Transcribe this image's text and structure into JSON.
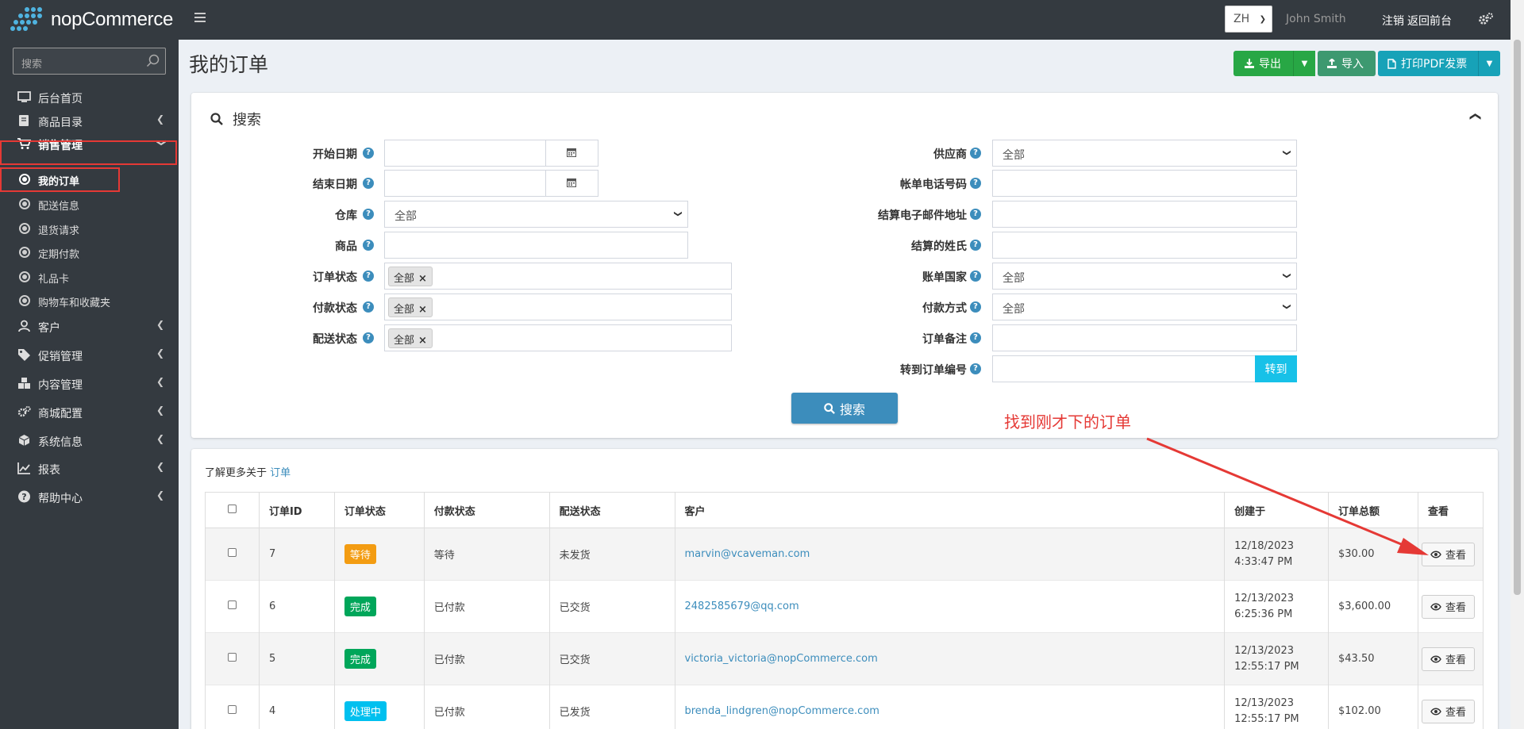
{
  "brand": {
    "name": "nopCommerce"
  },
  "topbar": {
    "language": "ZH",
    "user": "John Smith",
    "logout": "注销",
    "back_to_store": "返回前台"
  },
  "sidebar": {
    "search_placeholder": "搜索",
    "items": [
      {
        "label": "后台首页",
        "icon": "monitor-icon"
      },
      {
        "label": "商品目录",
        "icon": "book-icon"
      },
      {
        "label": "销售管理",
        "icon": "cart-icon"
      },
      {
        "label": "客户",
        "icon": "user-icon"
      },
      {
        "label": "促销管理",
        "icon": "tags-icon"
      },
      {
        "label": "内容管理",
        "icon": "cubes-icon"
      },
      {
        "label": "商城配置",
        "icon": "gears-icon"
      },
      {
        "label": "系统信息",
        "icon": "cube-icon"
      },
      {
        "label": "报表",
        "icon": "chart-icon"
      },
      {
        "label": "帮助中心",
        "icon": "question-icon"
      }
    ],
    "sales_sub": [
      {
        "label": "我的订单"
      },
      {
        "label": "配送信息"
      },
      {
        "label": "退货请求"
      },
      {
        "label": "定期付款"
      },
      {
        "label": "礼品卡"
      },
      {
        "label": "购物车和收藏夹"
      }
    ]
  },
  "page": {
    "title": "我的订单",
    "export_label": "导出",
    "import_label": "导入",
    "print_pdf_label": "打印PDF发票"
  },
  "search_panel": {
    "title": "搜索",
    "left": {
      "start_date": "开始日期",
      "end_date": "结束日期",
      "warehouse": "仓库",
      "warehouse_value": "全部",
      "product": "商品",
      "order_status": "订单状态",
      "order_status_tag": "全部",
      "payment_status": "付款状态",
      "payment_status_tag": "全部",
      "shipping_status": "配送状态",
      "shipping_status_tag": "全部"
    },
    "right": {
      "vendor": "供应商",
      "vendor_value": "全部",
      "billing_phone": "帐单电话号码",
      "billing_email": "结算电子邮件地址",
      "billing_lastname": "结算的姓氏",
      "billing_country": "账单国家",
      "billing_country_value": "全部",
      "payment_method": "付款方式",
      "payment_method_value": "全部",
      "order_notes": "订单备注",
      "goto_order": "转到订单编号",
      "goto_button": "转到"
    },
    "search_button": "搜索"
  },
  "annotation": {
    "text": "找到刚才下的订单"
  },
  "orders": {
    "learn_more_prefix": "了解更多关于",
    "learn_more_link": "订单",
    "columns": [
      "订单ID",
      "订单状态",
      "付款状态",
      "配送状态",
      "客户",
      "创建于",
      "订单总额",
      "查看"
    ],
    "view_label": "查看",
    "rows": [
      {
        "id": "7",
        "order_status": "等待",
        "status_color": "#f39c12",
        "payment": "等待",
        "shipping": "未发货",
        "customer": "marvin@vcaveman.com",
        "date": "12/18/2023",
        "time": "4:33:47 PM",
        "total": "$30.00"
      },
      {
        "id": "6",
        "order_status": "完成",
        "status_color": "#00a65a",
        "payment": "已付款",
        "shipping": "已交货",
        "customer": "2482585679@qq.com",
        "date": "12/13/2023",
        "time": "6:25:36 PM",
        "total": "$3,600.00"
      },
      {
        "id": "5",
        "order_status": "完成",
        "status_color": "#00a65a",
        "payment": "已付款",
        "shipping": "已交货",
        "customer": "victoria_victoria@nopCommerce.com",
        "date": "12/13/2023",
        "time": "12:55:17 PM",
        "total": "$43.50"
      },
      {
        "id": "4",
        "order_status": "处理中",
        "status_color": "#00c0ef",
        "payment": "已付款",
        "shipping": "已发货",
        "customer": "brenda_lindgren@nopCommerce.com",
        "date": "12/13/2023",
        "time": "12:55:17 PM",
        "total": "$102.00"
      }
    ]
  }
}
